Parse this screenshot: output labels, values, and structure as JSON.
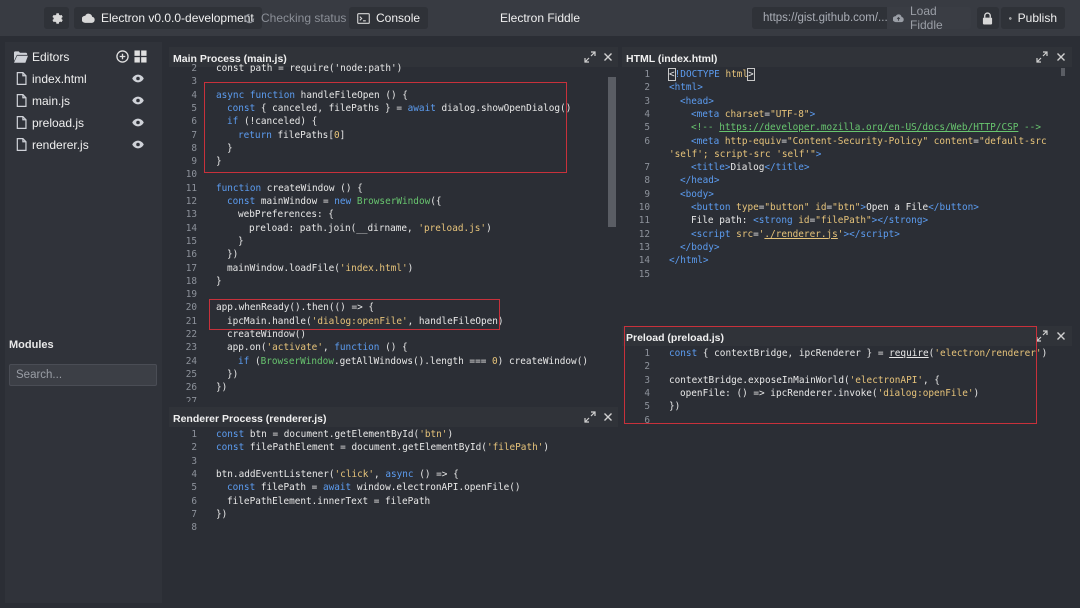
{
  "toolbar": {
    "version_label": "Electron v0.0.0-development",
    "status_label": "Checking status",
    "console_label": "Console",
    "app_title": "Electron Fiddle",
    "gist_placeholder": "https://gist.github.com/...",
    "load_label": "Load Fiddle",
    "publish_label": "Publish"
  },
  "sidebar": {
    "editors_label": "Editors",
    "files": [
      {
        "name": "index.html"
      },
      {
        "name": "main.js"
      },
      {
        "name": "preload.js"
      },
      {
        "name": "renderer.js"
      }
    ],
    "modules_label": "Modules",
    "search_placeholder": "Search..."
  },
  "panels": {
    "main": {
      "title": "Main Process (main.js)",
      "line_numbers": [
        "2",
        "3",
        "4",
        "5",
        "6",
        "7",
        "8",
        "9",
        "10",
        "11",
        "12",
        "13",
        "14",
        "15",
        "16",
        "17",
        "18",
        "19",
        "20",
        "21",
        "22",
        "23",
        "24",
        "25",
        "26",
        "27"
      ]
    },
    "renderer": {
      "title": "Renderer Process (renderer.js)",
      "line_numbers": [
        "1",
        "2",
        "3",
        "4",
        "5",
        "6",
        "7",
        "8"
      ]
    },
    "html": {
      "title": "HTML (index.html)",
      "line_numbers": [
        "1",
        "2",
        "3",
        "4",
        "5",
        "6",
        "",
        "7",
        "8",
        "9",
        "10",
        "11",
        "12",
        "13",
        "14",
        "15"
      ]
    },
    "preload": {
      "title": "Preload (preload.js)",
      "line_numbers": [
        "1",
        "2",
        "3",
        "4",
        "5",
        "6"
      ]
    }
  },
  "colors": {
    "accent_red": "#c8313b",
    "keyword": "#5c9cf0",
    "string": "#e6c37a",
    "class": "#68c56f"
  }
}
